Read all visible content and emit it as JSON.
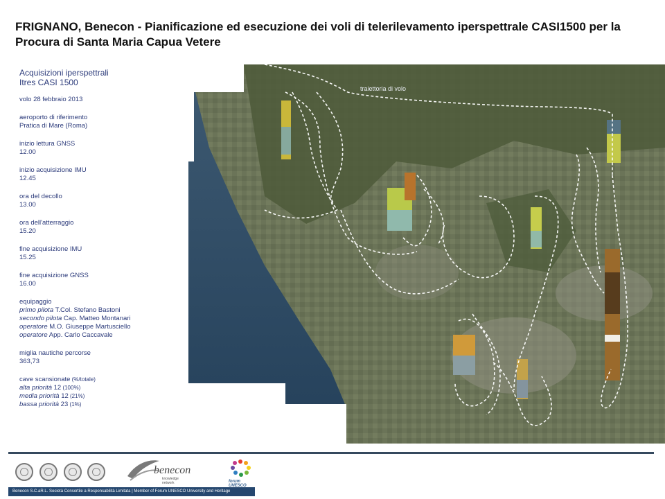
{
  "title": "FRIGNANO, Benecon - Pianificazione ed esecuzione dei voli di telerilevamento iperspettrale CASI1500 per la Procura di Santa Maria Capua Vetere",
  "sidebar": {
    "heading_1": "Acquisizioni iperspettrali",
    "heading_2": "Itres CASI 1500",
    "flight": "volo 28 febbraio 2013",
    "airport_label": "aeroporto di riferimento",
    "airport_value": "Pratica di Mare (Roma)",
    "gnss_start_label": "inizio lettura GNSS",
    "gnss_start_value": "12.00",
    "imu_start_label": "inizio acquisizione IMU",
    "imu_start_value": "12.45",
    "takeoff_label": "ora del decollo",
    "takeoff_value": "13.00",
    "landing_label": "ora dell'atterraggio",
    "landing_value": "15.20",
    "imu_end_label": "fine acquisizione IMU",
    "imu_end_value": "15.25",
    "gnss_end_label": "fine acquisizione GNSS",
    "gnss_end_value": "16.00",
    "crew_label": "equipaggio",
    "crew": [
      {
        "role": "primo pilota",
        "name": " T.Col. Stefano Bastoni"
      },
      {
        "role": "secondo pilota",
        "name": " Cap. Matteo Montanari"
      },
      {
        "role": "operatore",
        "name": " M.O. Giuseppe Martusciello"
      },
      {
        "role": "operatore",
        "name": " App. Carlo Caccavale"
      }
    ],
    "miles_label": "miglia nautiche percorse",
    "miles_value": "363,73",
    "quarries_label": "cave scansionate",
    "quarries_unit": " (%/totale)",
    "priorities": [
      {
        "label": "alta priorità",
        "count": " 12",
        "pct": " (100%)"
      },
      {
        "label": "media priorità",
        "count": " 12",
        "pct": " (21%)"
      },
      {
        "label": "bassa priorità",
        "count": " 23",
        "pct": " (1%)"
      }
    ]
  },
  "map": {
    "route_label": "traiettoria di volo",
    "colors": {
      "land": "#5d6b48",
      "sea": "#2f4a60",
      "urban": "#9a9a8c",
      "route": "#ffffff"
    }
  },
  "footer": {
    "text": "Benecon S.C.aR.L. Società Consortile a Responsabilità Limitata | Member of Forum UNESCO University and Heritage",
    "benecon_logo": "benecon",
    "benecon_sub": "knowledge network",
    "forum_logo": "forum UNESCO",
    "bar_color": "#25476f"
  }
}
